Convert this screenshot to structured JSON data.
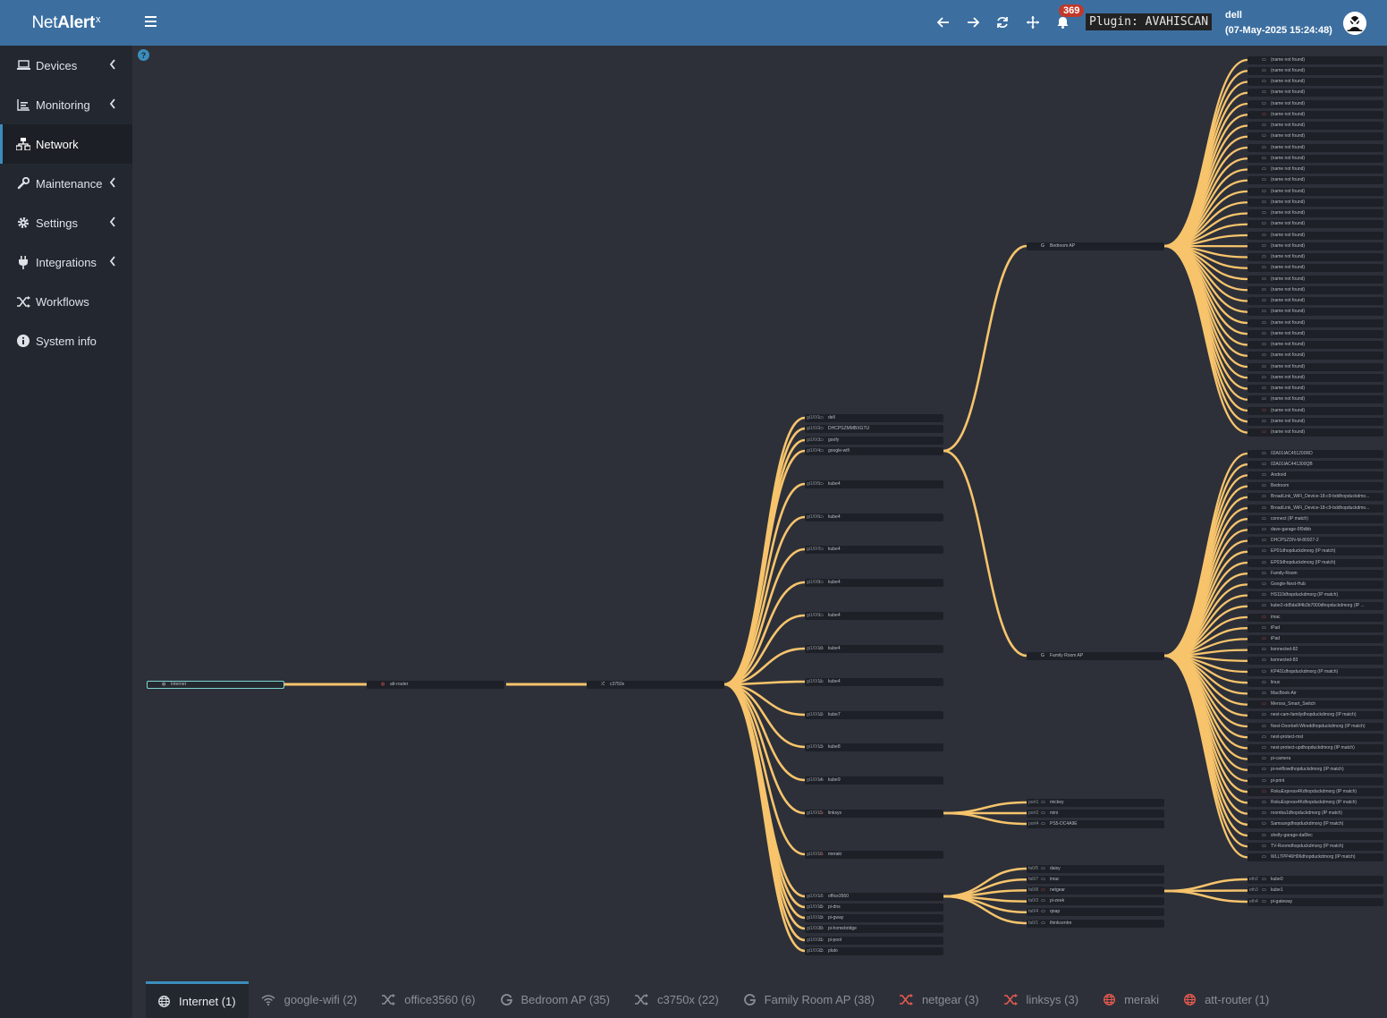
{
  "app": {
    "brand_net": "Net",
    "brand_alert": "Alert",
    "brand_sup": "x"
  },
  "sidebar": {
    "items": [
      {
        "label": "Devices",
        "icon": "laptop-icon",
        "has_chevron": true
      },
      {
        "label": "Monitoring",
        "icon": "chart-icon",
        "has_chevron": true
      },
      {
        "label": "Network",
        "icon": "network-icon",
        "has_chevron": false,
        "active": true
      },
      {
        "label": "Maintenance",
        "icon": "wrench-icon",
        "has_chevron": true
      },
      {
        "label": "Settings",
        "icon": "gear-icon",
        "has_chevron": true
      },
      {
        "label": "Integrations",
        "icon": "plug-icon",
        "has_chevron": true
      },
      {
        "label": "Workflows",
        "icon": "shuffle-icon",
        "has_chevron": false
      },
      {
        "label": "System info",
        "icon": "info-icon",
        "has_chevron": false
      }
    ]
  },
  "header": {
    "notification_count": "369",
    "plugin_label": "Plugin: AVAHISCAN",
    "user_name": "dell",
    "user_time": "(07-May-2025 15:24:48)"
  },
  "colors": {
    "accent": "#3c6fa0",
    "link": "#f7c46c",
    "sidebar": "#232830",
    "canvas": "#2d3039",
    "red_icon": "#e65a4f",
    "root_border": "#7fd6d0"
  },
  "tree": {
    "root": {
      "label": "Internet",
      "icon": "globe"
    },
    "router": {
      "label": "att-router",
      "icon": "globe-red"
    },
    "switch": {
      "label": "c3750x",
      "icon": "shuffle"
    },
    "switch_children": [
      {
        "port": "gi1/0/1",
        "label": "dell"
      },
      {
        "port": "gi1/0/2",
        "label": "DHCPSZMMBXGTU"
      },
      {
        "port": "gi1/0/3",
        "label": "goofy"
      },
      {
        "port": "gi1/0/4",
        "label": "google-wifi"
      },
      {
        "port": "gi1/0/5",
        "label": "kube4"
      },
      {
        "port": "gi1/0/6",
        "label": "kube4"
      },
      {
        "port": "gi1/0/7",
        "label": "kube4"
      },
      {
        "port": "gi1/0/8",
        "label": "kube4"
      },
      {
        "port": "gi1/0/9",
        "label": "kube4"
      },
      {
        "port": "gi1/0/10",
        "label": "kube4"
      },
      {
        "port": "gi1/0/11",
        "label": "kube4"
      },
      {
        "port": "gi1/0/12",
        "label": "kube7"
      },
      {
        "port": "gi1/0/13",
        "label": "kube8"
      },
      {
        "port": "gi1/0/14",
        "label": "kube9"
      },
      {
        "port": "gi1/0/15",
        "label": "linksys"
      },
      {
        "port": "gi1/0/16",
        "label": "meraki"
      },
      {
        "port": "gi1/0/17",
        "label": "office3560"
      },
      {
        "port": "gi1/0/18",
        "label": "pi-dns"
      },
      {
        "port": "gi1/0/19",
        "label": "pi-gway"
      },
      {
        "port": "gi1/0/20",
        "label": "pi-homebridge"
      },
      {
        "port": "gi1/0/21",
        "label": "pi-pool"
      },
      {
        "port": "gi1/0/22",
        "label": "pluto"
      }
    ],
    "google_wifi_children": [
      {
        "label": "Bedroom AP"
      },
      {
        "label": "Family Room AP"
      }
    ],
    "bedroom_ap_children_label": "(name not found)",
    "bedroom_ap_count": 35,
    "family_room_children": [
      "02A01IAC451200RD",
      "02A01IAC441300QB",
      "Android",
      "Bedroom",
      "BroadLink_WiFi_Device-18-c9-bddhopduckdmo...",
      "BroadLink_WiFi_Device-18-c9-bddhopduckdmo...",
      "connect (IP match)",
      "dave-garage-6f9dbb",
      "DHCPSZDN-M-80927-2",
      "EP01dhopduckdmorg (IP match)",
      "EP03dhopduckdmorg (IP match)",
      "Family-Room",
      "Google-Nest-Hub",
      "HS110dhopduckdmorg (IP match)",
      "kube2-dd5da9f4b3b7000dhopduckdmorg (IP ...",
      "imac",
      "iPad",
      "iPad",
      "konnected-82",
      "konnected-83",
      "KP401dhopduckdmorg (IP match)",
      "linux",
      "MacBook-Air",
      "Meross_Smart_Switch",
      "nest-cam-familydhopduckdmorg (IP match)",
      "Nest-Doorbell-Wireddhopduckdmorg (IP match)",
      "nest-protect-mst",
      "nest-protect-updhopduckdmorg (IP match)",
      "pi-camera",
      "pi-netflowdhopduckdmorg (IP match)",
      "pi-print",
      "RokuExpress4Kdhopduckdmorg (IP match)",
      "RokuExpress4Kdhopduckdmorg (IP match)",
      "roomba1dhopduckdmorg (IP match)",
      "Samsungdhopduckdmorg (IP match)",
      "shelly-garage-da6fec",
      "TV-Roomdhopduckdmorg (IP match)",
      "WLLTPP46H06dhopduckdmorg (IP match)"
    ],
    "linksys_children": [
      {
        "port": "port1",
        "label": "mickey"
      },
      {
        "port": "port2",
        "label": "mini"
      },
      {
        "port": "port4",
        "label": "PS5-DC4A9E"
      }
    ],
    "office_children": [
      {
        "port": "fa0/5",
        "label": "daisy"
      },
      {
        "port": "fa0/7",
        "label": "imac"
      },
      {
        "port": "fa0/8",
        "label": "netgear"
      },
      {
        "port": "fa0/3",
        "label": "pi-zeek"
      },
      {
        "port": "fa0/4",
        "label": "qnap"
      },
      {
        "port": "fa0/1",
        "label": "thinkcentre"
      }
    ],
    "netgear_children": [
      {
        "port": "eth2",
        "label": "kube0"
      },
      {
        "port": "eth3",
        "label": "kube1"
      },
      {
        "port": "eth4",
        "label": "pi-gateway"
      }
    ]
  },
  "tabs": [
    {
      "label": "Internet (1)",
      "icon": "globe-icon",
      "active": true,
      "color": "#d8dbe2"
    },
    {
      "label": "google-wifi (2)",
      "icon": "wifi-icon",
      "color": "#8a8f97"
    },
    {
      "label": "office3560 (6)",
      "icon": "shuffle-icon",
      "color": "#8a8f97"
    },
    {
      "label": "Bedroom AP (35)",
      "icon": "google-icon",
      "color": "#8a8f97"
    },
    {
      "label": "c3750x (22)",
      "icon": "shuffle-icon",
      "color": "#8a8f97"
    },
    {
      "label": "Family Room AP (38)",
      "icon": "google-icon",
      "color": "#8a8f97"
    },
    {
      "label": "netgear (3)",
      "icon": "shuffle-icon",
      "color": "#e65a4f"
    },
    {
      "label": "linksys (3)",
      "icon": "shuffle-icon",
      "color": "#e65a4f"
    },
    {
      "label": "meraki",
      "icon": "globe-icon",
      "color": "#e65a4f"
    },
    {
      "label": "att-router (1)",
      "icon": "globe-icon",
      "color": "#e65a4f"
    }
  ]
}
